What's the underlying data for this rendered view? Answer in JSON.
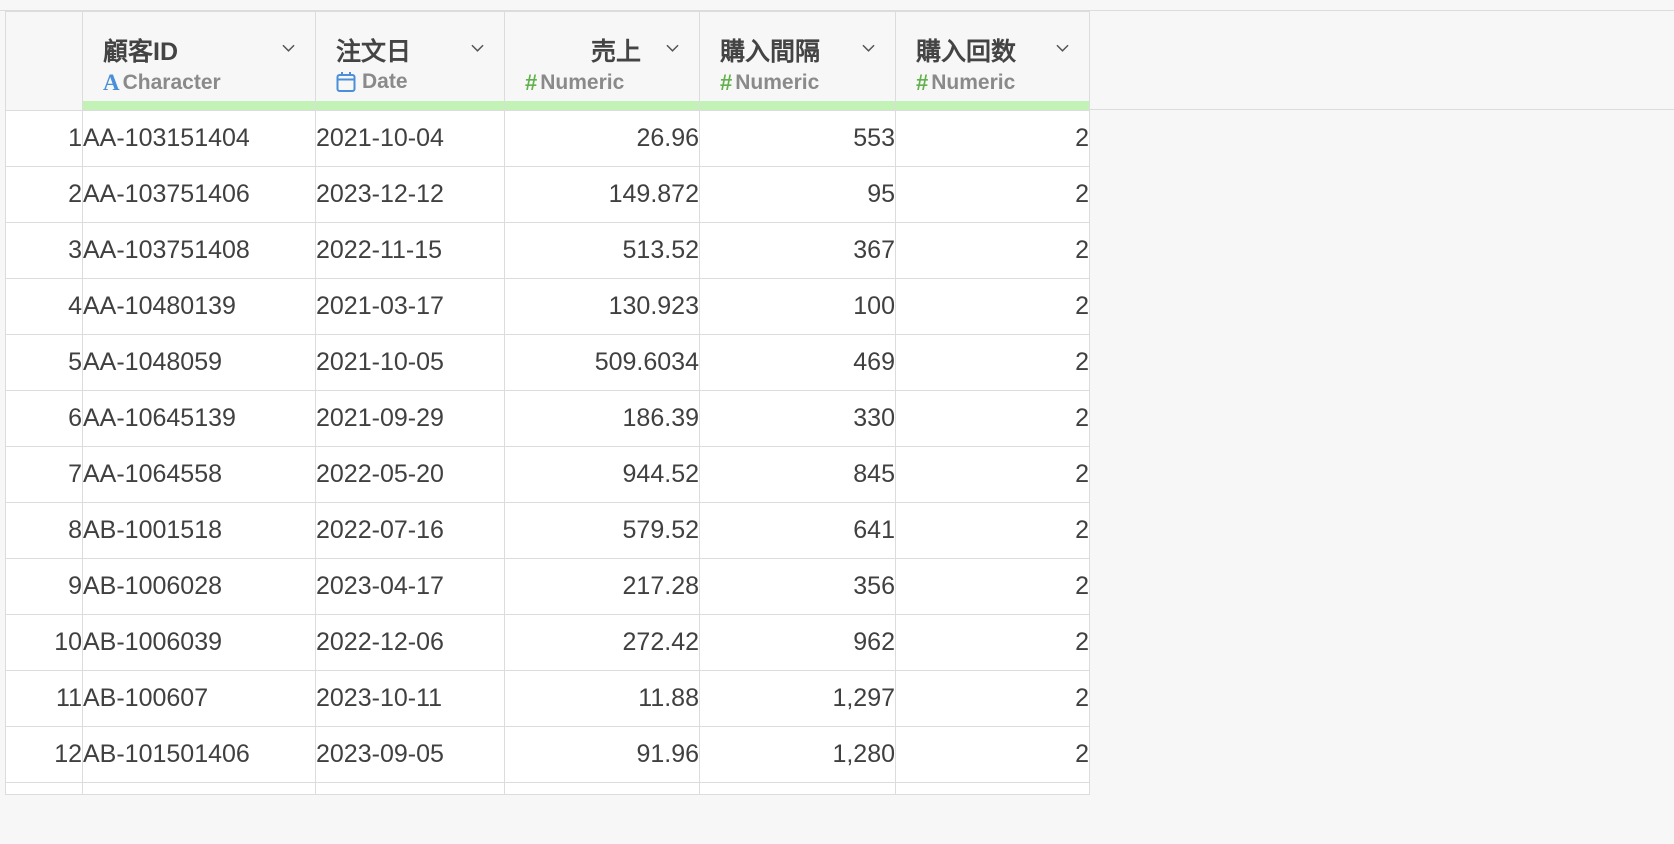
{
  "columns": [
    {
      "name": "顧客ID",
      "type": "Character",
      "type_icon": "character-icon",
      "align": "left"
    },
    {
      "name": "注文日",
      "type": "Date",
      "type_icon": "calendar-icon",
      "align": "left"
    },
    {
      "name": "売上",
      "type": "Numeric",
      "type_icon": "hash-icon",
      "align": "right"
    },
    {
      "name": "購入間隔",
      "type": "Numeric",
      "type_icon": "hash-icon",
      "align": "left"
    },
    {
      "name": "購入回数",
      "type": "Numeric",
      "type_icon": "hash-icon",
      "align": "left"
    }
  ],
  "rows": [
    {
      "n": "1",
      "cells": [
        "AA-103151404",
        "2021-10-04",
        "26.96",
        "553",
        "2"
      ]
    },
    {
      "n": "2",
      "cells": [
        "AA-103751406",
        "2023-12-12",
        "149.872",
        "95",
        "2"
      ]
    },
    {
      "n": "3",
      "cells": [
        "AA-103751408",
        "2022-11-15",
        "513.52",
        "367",
        "2"
      ]
    },
    {
      "n": "4",
      "cells": [
        "AA-10480139",
        "2021-03-17",
        "130.923",
        "100",
        "2"
      ]
    },
    {
      "n": "5",
      "cells": [
        "AA-1048059",
        "2021-10-05",
        "509.6034",
        "469",
        "2"
      ]
    },
    {
      "n": "6",
      "cells": [
        "AA-10645139",
        "2021-09-29",
        "186.39",
        "330",
        "2"
      ]
    },
    {
      "n": "7",
      "cells": [
        "AA-1064558",
        "2022-05-20",
        "944.52",
        "845",
        "2"
      ]
    },
    {
      "n": "8",
      "cells": [
        "AB-1001518",
        "2022-07-16",
        "579.52",
        "641",
        "2"
      ]
    },
    {
      "n": "9",
      "cells": [
        "AB-1006028",
        "2023-04-17",
        "217.28",
        "356",
        "2"
      ]
    },
    {
      "n": "10",
      "cells": [
        "AB-1006039",
        "2022-12-06",
        "272.42",
        "962",
        "2"
      ]
    },
    {
      "n": "11",
      "cells": [
        "AB-100607",
        "2023-10-11",
        "11.88",
        "1,297",
        "2"
      ]
    },
    {
      "n": "12",
      "cells": [
        "AB-101501406",
        "2023-09-05",
        "91.96",
        "1,280",
        "2"
      ]
    }
  ],
  "colors": {
    "header_bar": "#c3f2b7",
    "character_icon": "#4a8fd8",
    "numeric_icon": "#62b04e",
    "date_icon": "#4a8fd8"
  }
}
